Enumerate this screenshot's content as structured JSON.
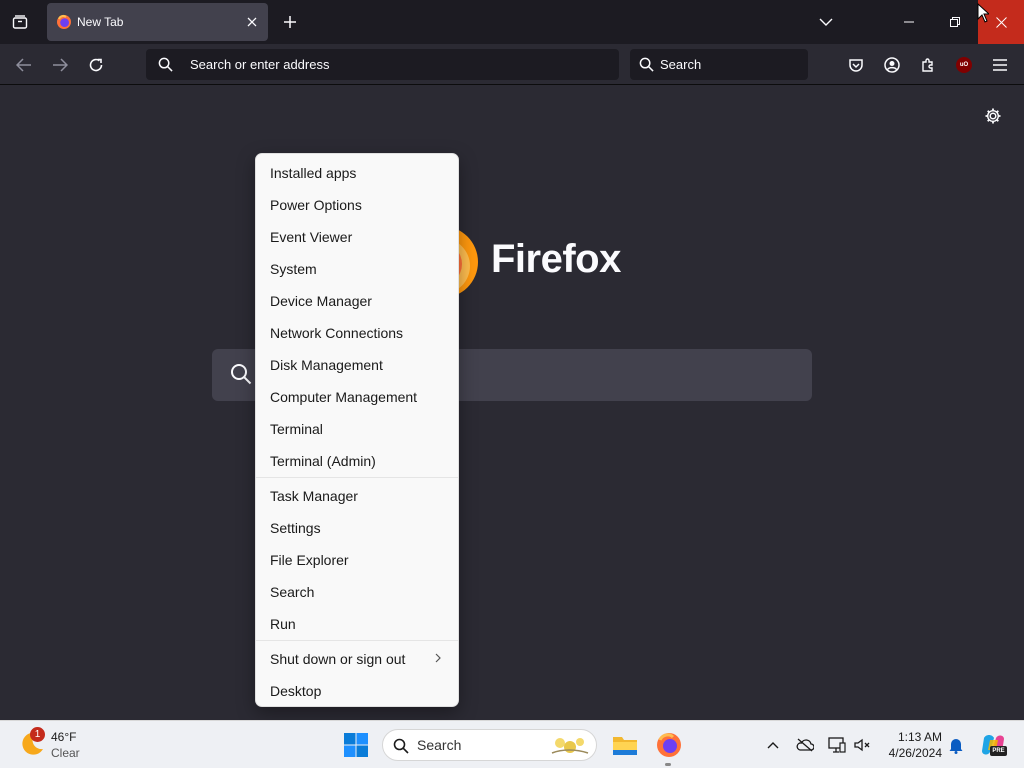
{
  "browser": {
    "tab": {
      "title": "New Tab",
      "icon": "firefox-icon"
    },
    "urlbar": {
      "placeholder": "Search or enter address"
    },
    "searchbar": {
      "placeholder": "Search"
    },
    "icons": {
      "tab_list": "tab-list-icon",
      "new_tab": "plus-icon",
      "list_all_tabs": "chevron-down-icon",
      "back": "back-arrow-icon",
      "forward": "forward-arrow-icon",
      "reload": "reload-icon",
      "pocket": "pocket-icon",
      "account": "account-icon",
      "extensions": "puzzle-icon",
      "ublock": "ublock-origin-icon",
      "menu": "hamburger-menu-icon"
    },
    "ublock_label": "uO"
  },
  "new_tab_page": {
    "brand": "Firefox",
    "settings_icon": "gear-icon",
    "search_icon": "search-icon"
  },
  "context_menu": {
    "items": [
      {
        "label": "Installed apps"
      },
      {
        "label": "Power Options"
      },
      {
        "label": "Event Viewer"
      },
      {
        "label": "System"
      },
      {
        "label": "Device Manager"
      },
      {
        "label": "Network Connections"
      },
      {
        "label": "Disk Management"
      },
      {
        "label": "Computer Management"
      },
      {
        "label": "Terminal"
      },
      {
        "label": "Terminal (Admin)"
      },
      {
        "label": "Task Manager"
      },
      {
        "label": "Settings"
      },
      {
        "label": "File Explorer"
      },
      {
        "label": "Search"
      },
      {
        "label": "Run"
      },
      {
        "label": "Shut down or sign out",
        "submenu": true
      },
      {
        "label": "Desktop"
      }
    ]
  },
  "taskbar": {
    "weather": {
      "temp": "46°F",
      "condition": "Clear",
      "badge": "1"
    },
    "search_placeholder": "Search",
    "pinned_apps": [
      "file-explorer-icon",
      "firefox-icon"
    ],
    "tray_icons": [
      "chevron-up-icon",
      "onedrive-offline-icon",
      "display-icon",
      "speaker-muted-icon"
    ],
    "clock": {
      "time": "1:13 AM",
      "date": "4/26/2024"
    },
    "copilot_badge": "PRE"
  },
  "colors": {
    "toolbar_bg": "#2b2a33",
    "tabstrip_bg": "#1c1b22",
    "selected_tab": "#42414d",
    "window_close_hover": "#c42b1c",
    "menu_bg": "#f9f9f9",
    "taskbar_bg": "#eef0f4"
  }
}
